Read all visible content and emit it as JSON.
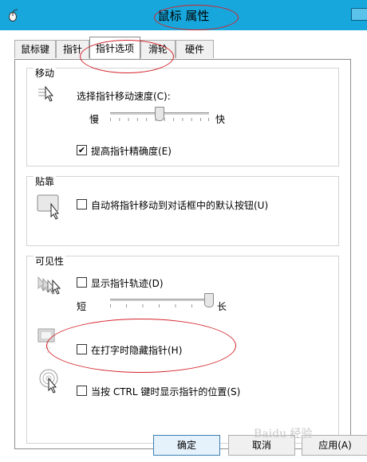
{
  "window": {
    "title": "鼠标 属性",
    "icon": "mouse-icon"
  },
  "tabs": [
    {
      "label": "鼠标键"
    },
    {
      "label": "指针"
    },
    {
      "label": "指针选项",
      "active": true
    },
    {
      "label": "滑轮"
    },
    {
      "label": "硬件"
    }
  ],
  "motion": {
    "title": "移动",
    "speed_label": "选择指针移动速度(C):",
    "slow": "慢",
    "fast": "快",
    "speed_level": 0.5,
    "precision_label": "提高指针精确度(E)",
    "precision_checked": true
  },
  "snap": {
    "title": "贴靠",
    "snap_label": "自动将指针移动到对话框中的默认按钮(U)",
    "snap_checked": false
  },
  "visibility": {
    "title": "可见性",
    "trails_label": "显示指针轨迹(D)",
    "trails_checked": false,
    "short": "短",
    "long": "长",
    "trail_level": 1.0,
    "hide_label": "在打字时隐藏指针(H)",
    "hide_checked": false,
    "ctrl_label": "当按 CTRL 键时显示指针的位置(S)",
    "ctrl_checked": false
  },
  "buttons": {
    "ok": "确定",
    "cancel": "取消",
    "apply": "应用(A)"
  },
  "watermark": "Baidu 经验",
  "colors": {
    "titlebar": "#17a7dc",
    "annotation": "#d4232b"
  }
}
